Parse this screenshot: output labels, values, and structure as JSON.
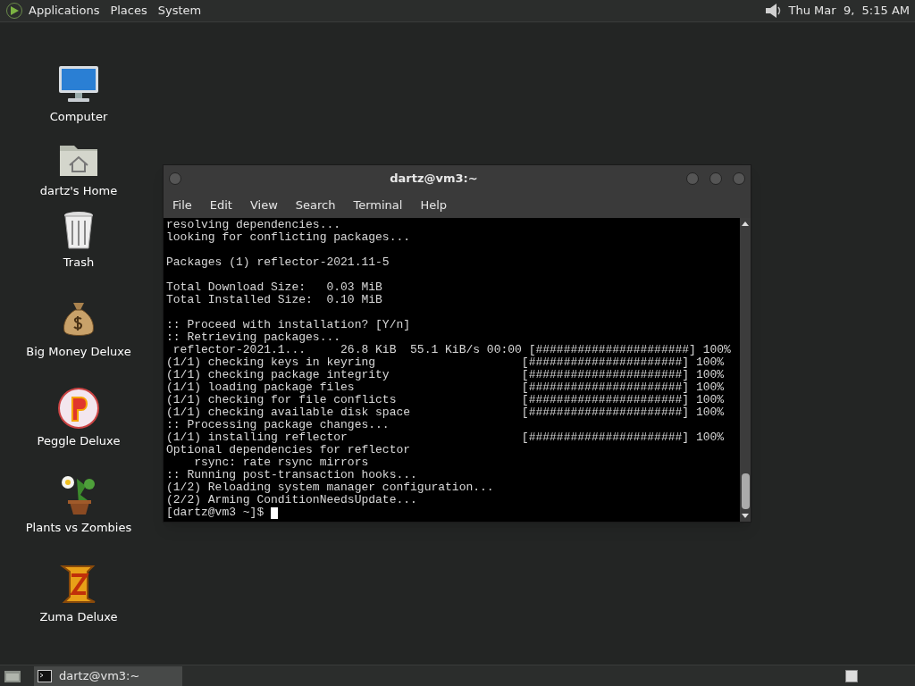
{
  "top_panel": {
    "menus": [
      "Applications",
      "Places",
      "System"
    ],
    "clock": "Thu Mar  9,  5:15 AM"
  },
  "desktop_icons": [
    {
      "kind": "computer",
      "label": "Computer"
    },
    {
      "kind": "home",
      "label": "dartz's Home"
    },
    {
      "kind": "trash",
      "label": "Trash"
    },
    {
      "kind": "moneybag",
      "label": "Big Money Deluxe"
    },
    {
      "kind": "peggle",
      "label": "Peggle Deluxe"
    },
    {
      "kind": "plant",
      "label": "Plants vs Zombies"
    },
    {
      "kind": "zuma",
      "label": "Zuma Deluxe"
    }
  ],
  "window": {
    "title": "dartz@vm3:~",
    "menu": [
      "File",
      "Edit",
      "View",
      "Search",
      "Terminal",
      "Help"
    ],
    "terminal": {
      "blocks": [
        [
          "resolving dependencies...",
          "looking for conflicting packages..."
        ],
        [
          "Packages (1) reflector-2021.11-5"
        ],
        [
          "Total Download Size:   0.03 MiB",
          "Total Installed Size:  0.10 MiB"
        ],
        [
          ":: Proceed with installation? [Y/n]",
          ":: Retrieving packages...",
          " reflector-2021.1...     26.8 KiB  55.1 KiB/s 00:00 [######################] 100%",
          "(1/1) checking keys in keyring                     [######################] 100%",
          "(1/1) checking package integrity                   [######################] 100%",
          "(1/1) loading package files                        [######################] 100%",
          "(1/1) checking for file conflicts                  [######################] 100%",
          "(1/1) checking available disk space                [######################] 100%",
          ":: Processing package changes...",
          "(1/1) installing reflector                         [######################] 100%",
          "Optional dependencies for reflector",
          "    rsync: rate rsync mirrors",
          ":: Running post-transaction hooks...",
          "(1/2) Reloading system manager configuration...",
          "(2/2) Arming ConditionNeedsUpdate..."
        ]
      ],
      "prompt": "[dartz@vm3 ~]$"
    }
  },
  "taskbar": {
    "tasks": [
      {
        "label": "dartz@vm3:~",
        "selected": true
      }
    ]
  }
}
